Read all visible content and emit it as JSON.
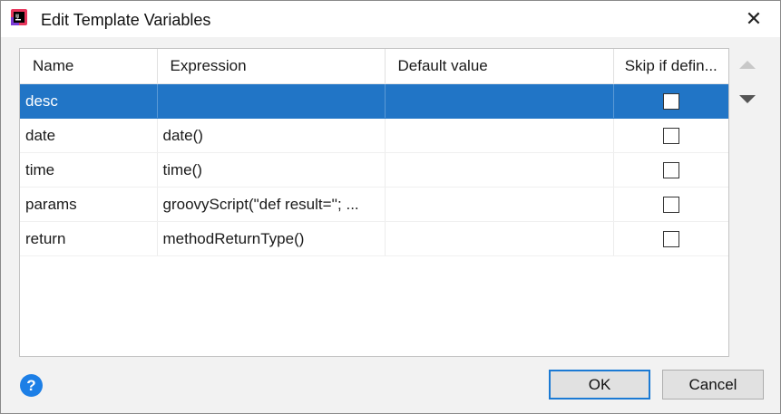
{
  "window": {
    "title": "Edit Template Variables",
    "close_glyph": "✕",
    "app_icon": "intellij-icon"
  },
  "table": {
    "columns": [
      "Name",
      "Expression",
      "Default value",
      "Skip if defin..."
    ],
    "rows": [
      {
        "name": "desc",
        "expression": "",
        "default_value": "",
        "skip_if_defined": false,
        "selected": true
      },
      {
        "name": "date",
        "expression": "date()",
        "default_value": "",
        "skip_if_defined": false,
        "selected": false
      },
      {
        "name": "time",
        "expression": "time()",
        "default_value": "",
        "skip_if_defined": false,
        "selected": false
      },
      {
        "name": "params",
        "expression": "groovyScript(\"def result=''; ...",
        "default_value": "",
        "skip_if_defined": false,
        "selected": false
      },
      {
        "name": "return",
        "expression": "methodReturnType()",
        "default_value": "",
        "skip_if_defined": false,
        "selected": false
      }
    ],
    "move_up_enabled": false,
    "move_down_enabled": true
  },
  "footer": {
    "help_glyph": "?",
    "ok_label": "OK",
    "cancel_label": "Cancel"
  },
  "colors": {
    "selection": "#2175c6",
    "ok_border": "#1b7ad4",
    "help": "#1d7fe6"
  }
}
